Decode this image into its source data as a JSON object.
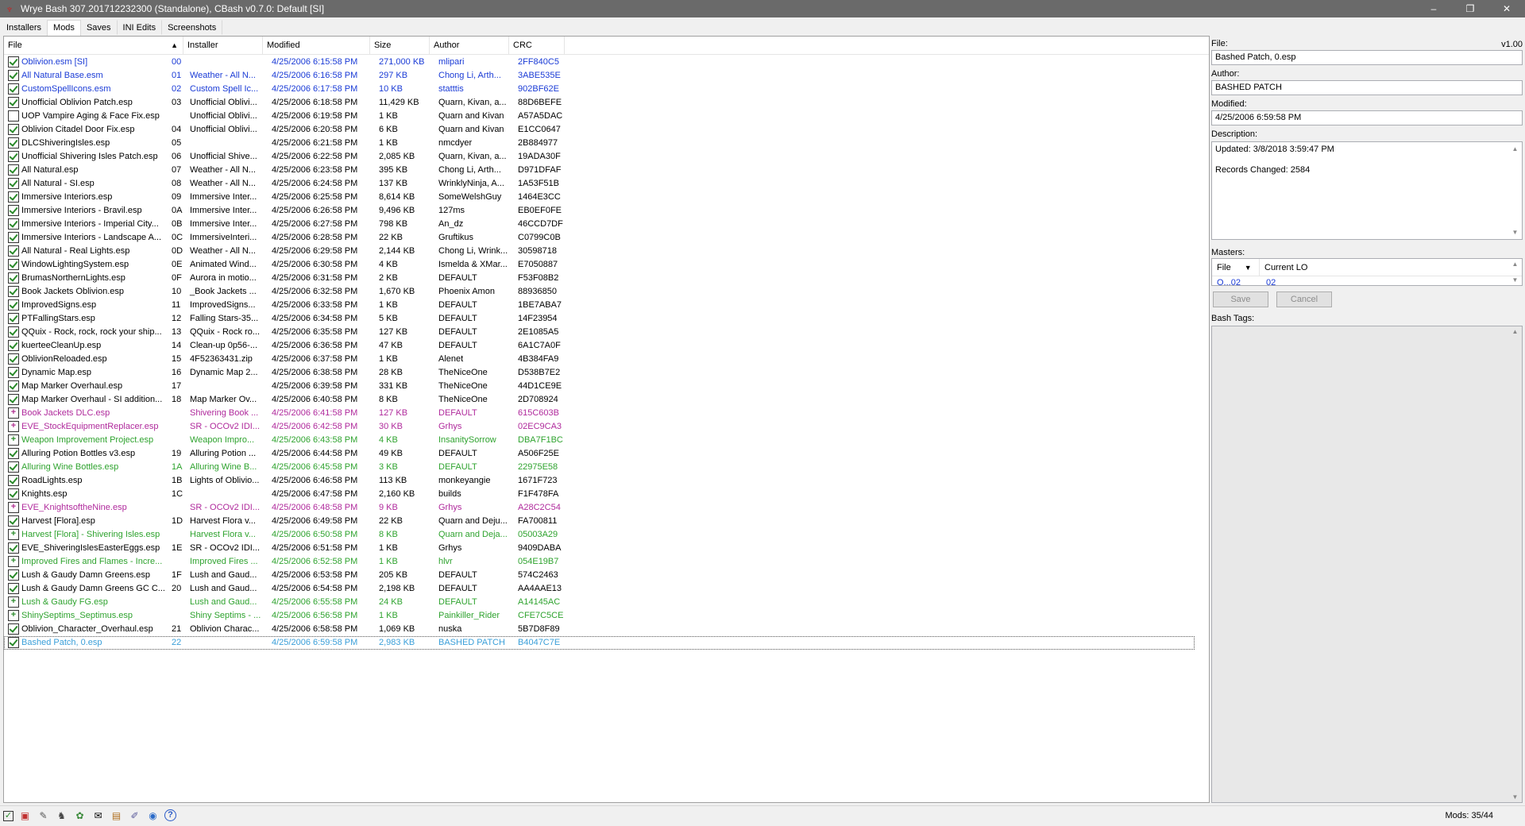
{
  "window": {
    "title": "Wrye Bash 307.201712232300 (Standalone), CBash v0.7.0: Default [SI]",
    "minimize": "–",
    "maximize": "❐",
    "close": "✕"
  },
  "tabs": [
    {
      "label": "Installers",
      "active": false
    },
    {
      "label": "Mods",
      "active": true
    },
    {
      "label": "Saves",
      "active": false
    },
    {
      "label": "INI Edits",
      "active": false
    },
    {
      "label": "Screenshots",
      "active": false
    }
  ],
  "columns": {
    "file": "File",
    "installer": "Installer",
    "modified": "Modified",
    "size": "Size",
    "author": "Author",
    "crc": "CRC"
  },
  "sort_icon": "sort-ascending-icon",
  "colors": {
    "black": "#000000",
    "blue": "#1a3bd6",
    "pink": "#b02a9c",
    "green": "#2fa32f",
    "lightblue": "#3a9fd9"
  },
  "mods": [
    {
      "name": "Oblivion.esm [SI]",
      "order": "00",
      "installer": "",
      "modified": "4/25/2006 6:15:58 PM",
      "size": "271,000 KB",
      "author": "mlipari",
      "crc": "2FF840C5",
      "color": "blue",
      "state": "checked"
    },
    {
      "name": "All Natural Base.esm",
      "order": "01",
      "installer": "Weather - All N...",
      "modified": "4/25/2006 6:16:58 PM",
      "size": "297 KB",
      "author": "Chong Li, Arth...",
      "crc": "3ABE535E",
      "color": "blue",
      "state": "checked"
    },
    {
      "name": "CustomSpellIcons.esm",
      "order": "02",
      "installer": "Custom Spell Ic...",
      "modified": "4/25/2006 6:17:58 PM",
      "size": "10 KB",
      "author": "statttis",
      "crc": "902BF62E",
      "color": "blue",
      "state": "checked"
    },
    {
      "name": "Unofficial Oblivion Patch.esp",
      "order": "03",
      "installer": "Unofficial Oblivi...",
      "modified": "4/25/2006 6:18:58 PM",
      "size": "11,429 KB",
      "author": "Quarn, Kivan, a...",
      "crc": "88D6BEFE",
      "color": "black",
      "state": "checked"
    },
    {
      "name": "UOP Vampire Aging & Face Fix.esp",
      "order": "",
      "installer": "Unofficial Oblivi...",
      "modified": "4/25/2006 6:19:58 PM",
      "size": "1 KB",
      "author": "Quarn and Kivan",
      "crc": "A57A5DAC",
      "color": "black",
      "state": "unchecked"
    },
    {
      "name": "Oblivion Citadel Door Fix.esp",
      "order": "04",
      "installer": "Unofficial Oblivi...",
      "modified": "4/25/2006 6:20:58 PM",
      "size": "6 KB",
      "author": "Quarn and Kivan",
      "crc": "E1CC0647",
      "color": "black",
      "state": "checked"
    },
    {
      "name": "DLCShiveringIsles.esp",
      "order": "05",
      "installer": "",
      "modified": "4/25/2006 6:21:58 PM",
      "size": "1 KB",
      "author": "nmcdyer",
      "crc": "2B884977",
      "color": "black",
      "state": "checked"
    },
    {
      "name": "Unofficial Shivering Isles Patch.esp",
      "order": "06",
      "installer": "Unofficial Shive...",
      "modified": "4/25/2006 6:22:58 PM",
      "size": "2,085 KB",
      "author": "Quarn, Kivan, a...",
      "crc": "19ADA30F",
      "color": "black",
      "state": "checked"
    },
    {
      "name": "All Natural.esp",
      "order": "07",
      "installer": "Weather - All N...",
      "modified": "4/25/2006 6:23:58 PM",
      "size": "395 KB",
      "author": "Chong Li, Arth...",
      "crc": "D971DFAF",
      "color": "black",
      "state": "checked"
    },
    {
      "name": "All Natural - SI.esp",
      "order": "08",
      "installer": "Weather - All N...",
      "modified": "4/25/2006 6:24:58 PM",
      "size": "137 KB",
      "author": "WrinklyNinja, A...",
      "crc": "1A53F51B",
      "color": "black",
      "state": "checked"
    },
    {
      "name": "Immersive Interiors.esp",
      "order": "09",
      "installer": "Immersive Inter...",
      "modified": "4/25/2006 6:25:58 PM",
      "size": "8,614 KB",
      "author": "SomeWelshGuy",
      "crc": "1464E3CC",
      "color": "black",
      "state": "checked"
    },
    {
      "name": "Immersive Interiors - Bravil.esp",
      "order": "0A",
      "installer": "Immersive Inter...",
      "modified": "4/25/2006 6:26:58 PM",
      "size": "9,496 KB",
      "author": "127ms",
      "crc": "EB0EF0FE",
      "color": "black",
      "state": "checked"
    },
    {
      "name": "Immersive Interiors - Imperial City...",
      "order": "0B",
      "installer": "Immersive Inter...",
      "modified": "4/25/2006 6:27:58 PM",
      "size": "798 KB",
      "author": "An_dz",
      "crc": "46CCD7DF",
      "color": "black",
      "state": "checked"
    },
    {
      "name": "Immersive Interiors - Landscape A...",
      "order": "0C",
      "installer": "ImmersiveInteri...",
      "modified": "4/25/2006 6:28:58 PM",
      "size": "22 KB",
      "author": "Gruftikus",
      "crc": "C0799C0B",
      "color": "black",
      "state": "checked"
    },
    {
      "name": "All Natural - Real Lights.esp",
      "order": "0D",
      "installer": "Weather - All N...",
      "modified": "4/25/2006 6:29:58 PM",
      "size": "2,144 KB",
      "author": "Chong Li, Wrink...",
      "crc": "30598718",
      "color": "black",
      "state": "checked"
    },
    {
      "name": "WindowLightingSystem.esp",
      "order": "0E",
      "installer": "Animated Wind...",
      "modified": "4/25/2006 6:30:58 PM",
      "size": "4 KB",
      "author": "Ismelda & XMar...",
      "crc": "E7050887",
      "color": "black",
      "state": "checked"
    },
    {
      "name": "BrumasNorthernLights.esp",
      "order": "0F",
      "installer": "Aurora in motio...",
      "modified": "4/25/2006 6:31:58 PM",
      "size": "2 KB",
      "author": "DEFAULT",
      "crc": "F53F08B2",
      "color": "black",
      "state": "checked"
    },
    {
      "name": "Book Jackets Oblivion.esp",
      "order": "10",
      "installer": "_Book Jackets ...",
      "modified": "4/25/2006 6:32:58 PM",
      "size": "1,670 KB",
      "author": "Phoenix Amon",
      "crc": "88936850",
      "color": "black",
      "state": "checked"
    },
    {
      "name": "ImprovedSigns.esp",
      "order": "11",
      "installer": "ImprovedSigns...",
      "modified": "4/25/2006 6:33:58 PM",
      "size": "1 KB",
      "author": "DEFAULT",
      "crc": "1BE7ABA7",
      "color": "black",
      "state": "checked"
    },
    {
      "name": "PTFallingStars.esp",
      "order": "12",
      "installer": "Falling Stars-35...",
      "modified": "4/25/2006 6:34:58 PM",
      "size": "5 KB",
      "author": "DEFAULT",
      "crc": "14F23954",
      "color": "black",
      "state": "checked"
    },
    {
      "name": "QQuix - Rock, rock, rock your ship...",
      "order": "13",
      "installer": "QQuix - Rock ro...",
      "modified": "4/25/2006 6:35:58 PM",
      "size": "127 KB",
      "author": "DEFAULT",
      "crc": "2E1085A5",
      "color": "black",
      "state": "checked"
    },
    {
      "name": "kuerteeCleanUp.esp",
      "order": "14",
      "installer": "Clean-up 0p56-...",
      "modified": "4/25/2006 6:36:58 PM",
      "size": "47 KB",
      "author": "DEFAULT",
      "crc": "6A1C7A0F",
      "color": "black",
      "state": "checked"
    },
    {
      "name": "OblivionReloaded.esp",
      "order": "15",
      "installer": "4F52363431.zip",
      "modified": "4/25/2006 6:37:58 PM",
      "size": "1 KB",
      "author": "Alenet",
      "crc": "4B384FA9",
      "color": "black",
      "state": "checked"
    },
    {
      "name": "Dynamic Map.esp",
      "order": "16",
      "installer": "Dynamic Map 2...",
      "modified": "4/25/2006 6:38:58 PM",
      "size": "28 KB",
      "author": "TheNiceOne",
      "crc": "D538B7E2",
      "color": "black",
      "state": "checked"
    },
    {
      "name": "Map Marker Overhaul.esp",
      "order": "17",
      "installer": "",
      "modified": "4/25/2006 6:39:58 PM",
      "size": "331 KB",
      "author": "TheNiceOne",
      "crc": "44D1CE9E",
      "color": "black",
      "state": "checked"
    },
    {
      "name": "Map Marker Overhaul - SI addition...",
      "order": "18",
      "installer": "Map Marker Ov...",
      "modified": "4/25/2006 6:40:58 PM",
      "size": "8 KB",
      "author": "TheNiceOne",
      "crc": "2D708924",
      "color": "black",
      "state": "checked"
    },
    {
      "name": "Book Jackets DLC.esp",
      "order": "",
      "installer": "Shivering Book ...",
      "modified": "4/25/2006 6:41:58 PM",
      "size": "127 KB",
      "author": "DEFAULT",
      "crc": "615C603B",
      "color": "pink",
      "state": "merged"
    },
    {
      "name": "EVE_StockEquipmentReplacer.esp",
      "order": "",
      "installer": "SR - OCOv2 IDI...",
      "modified": "4/25/2006 6:42:58 PM",
      "size": "30 KB",
      "author": "Grhys",
      "crc": "02EC9CA3",
      "color": "pink",
      "state": "merged"
    },
    {
      "name": "Weapon Improvement Project.esp",
      "order": "",
      "installer": "Weapon Impro...",
      "modified": "4/25/2006 6:43:58 PM",
      "size": "4 KB",
      "author": "InsanitySorrow",
      "crc": "DBA7F1BC",
      "color": "green",
      "state": "merged"
    },
    {
      "name": "Alluring Potion Bottles v3.esp",
      "order": "19",
      "installer": "Alluring Potion ...",
      "modified": "4/25/2006 6:44:58 PM",
      "size": "49 KB",
      "author": "DEFAULT",
      "crc": "A506F25E",
      "color": "black",
      "state": "checked"
    },
    {
      "name": "Alluring Wine Bottles.esp",
      "order": "1A",
      "installer": "Alluring Wine B...",
      "modified": "4/25/2006 6:45:58 PM",
      "size": "3 KB",
      "author": "DEFAULT",
      "crc": "22975E58",
      "color": "green",
      "state": "checked"
    },
    {
      "name": "RoadLights.esp",
      "order": "1B",
      "installer": "Lights of Oblivio...",
      "modified": "4/25/2006 6:46:58 PM",
      "size": "113 KB",
      "author": "monkeyangie",
      "crc": "1671F723",
      "color": "black",
      "state": "checked"
    },
    {
      "name": "Knights.esp",
      "order": "1C",
      "installer": "",
      "modified": "4/25/2006 6:47:58 PM",
      "size": "2,160 KB",
      "author": "builds",
      "crc": "F1F478FA",
      "color": "black",
      "state": "checked"
    },
    {
      "name": "EVE_KnightsoftheNine.esp",
      "order": "",
      "installer": "SR - OCOv2 IDI...",
      "modified": "4/25/2006 6:48:58 PM",
      "size": "9 KB",
      "author": "Grhys",
      "crc": "A28C2C54",
      "color": "pink",
      "state": "merged"
    },
    {
      "name": "Harvest [Flora].esp",
      "order": "1D",
      "installer": "Harvest Flora v...",
      "modified": "4/25/2006 6:49:58 PM",
      "size": "22 KB",
      "author": "Quarn and Deju...",
      "crc": "FA700811",
      "color": "black",
      "state": "checked"
    },
    {
      "name": "Harvest [Flora] - Shivering Isles.esp",
      "order": "",
      "installer": "Harvest Flora v...",
      "modified": "4/25/2006 6:50:58 PM",
      "size": "8 KB",
      "author": "Quarn and Deja...",
      "crc": "05003A29",
      "color": "green",
      "state": "merged"
    },
    {
      "name": "EVE_ShiveringIslesEasterEggs.esp",
      "order": "1E",
      "installer": "SR - OCOv2 IDI...",
      "modified": "4/25/2006 6:51:58 PM",
      "size": "1 KB",
      "author": "Grhys",
      "crc": "9409DABA",
      "color": "black",
      "state": "checked"
    },
    {
      "name": "Improved Fires and Flames - Incre...",
      "order": "",
      "installer": "Improved Fires ...",
      "modified": "4/25/2006 6:52:58 PM",
      "size": "1 KB",
      "author": "hlvr",
      "crc": "054E19B7",
      "color": "green",
      "state": "merged"
    },
    {
      "name": "Lush & Gaudy Damn Greens.esp",
      "order": "1F",
      "installer": "Lush and Gaud...",
      "modified": "4/25/2006 6:53:58 PM",
      "size": "205 KB",
      "author": "DEFAULT",
      "crc": "574C2463",
      "color": "black",
      "state": "checked"
    },
    {
      "name": "Lush & Gaudy Damn Greens GC C...",
      "order": "20",
      "installer": "Lush and Gaud...",
      "modified": "4/25/2006 6:54:58 PM",
      "size": "2,198 KB",
      "author": "DEFAULT",
      "crc": "AA4AAE13",
      "color": "black",
      "state": "checked"
    },
    {
      "name": "Lush & Gaudy FG.esp",
      "order": "",
      "installer": "Lush and Gaud...",
      "modified": "4/25/2006 6:55:58 PM",
      "size": "24 KB",
      "author": "DEFAULT",
      "crc": "A14145AC",
      "color": "green",
      "state": "merged"
    },
    {
      "name": "ShinySeptims_Septimus.esp",
      "order": "",
      "installer": "Shiny Septims - ...",
      "modified": "4/25/2006 6:56:58 PM",
      "size": "1 KB",
      "author": "Painkiller_Rider",
      "crc": "CFE7C5CE",
      "color": "green",
      "state": "merged"
    },
    {
      "name": "Oblivion_Character_Overhaul.esp",
      "order": "21",
      "installer": "Oblivion Charac...",
      "modified": "4/25/2006 6:58:58 PM",
      "size": "1,069 KB",
      "author": "nuska",
      "crc": "5B7D8F89",
      "color": "black",
      "state": "checked"
    },
    {
      "name": "Bashed Patch, 0.esp",
      "order": "22",
      "installer": "",
      "modified": "4/25/2006 6:59:58 PM",
      "size": "2,983 KB",
      "author": "BASHED PATCH",
      "crc": "B4047C7E",
      "color": "lightblue",
      "state": "checked",
      "selected": true
    }
  ],
  "details": {
    "file_label": "File:",
    "version": "v1.00",
    "file_value": "Bashed Patch, 0.esp",
    "author_label": "Author:",
    "author_value": "BASHED PATCH",
    "modified_label": "Modified:",
    "modified_value": "4/25/2006 6:59:58 PM",
    "description_label": "Description:",
    "description_line1": "Updated: 3/8/2018 3:59:47 PM",
    "description_line2": "Records Changed: 2584",
    "masters_label": "Masters:",
    "masters_col_file": "File",
    "masters_col_lo": "Current LO",
    "masters_row_file": "O...02",
    "masters_row_lo": "02",
    "save_label": "Save",
    "cancel_label": "Cancel",
    "bash_tags_label": "Bash Tags:"
  },
  "statusbar": {
    "icons": [
      "checkbox-icon",
      "settings-icon",
      "wrench-icon",
      "tes4edit-icon",
      "tes4lodgen-icon",
      "mail-icon",
      "doc-icon",
      "edit-icon",
      "bethesda-icon",
      "help-icon"
    ],
    "mods_count": "Mods: 35/44"
  }
}
